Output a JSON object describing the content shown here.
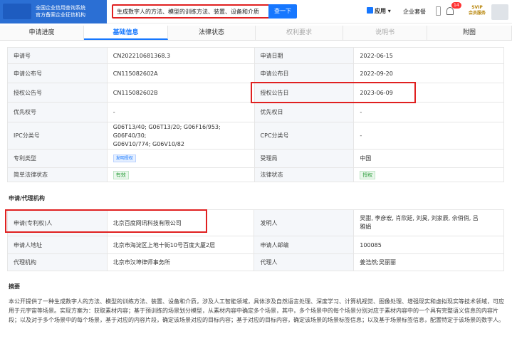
{
  "header": {
    "brand_line1": "全国企业信用查询系统",
    "brand_line2": "官方备案企业征信机构",
    "search_value": "生成数字人的方法、模型的训练方法、装置、设备和介质",
    "search_button": "查一下",
    "apps_label": "应用",
    "suite_label": "企业套餐",
    "notification_count": "14",
    "svip_line1": "SVIP",
    "svip_line2": "会员服务"
  },
  "tabs": [
    {
      "label": "申请进度"
    },
    {
      "label": "基础信息"
    },
    {
      "label": "法律状态"
    },
    {
      "label": "权利要求"
    },
    {
      "label": "说明书"
    },
    {
      "label": "附图"
    }
  ],
  "basic": {
    "app_no_label": "申请号",
    "app_no": "CN202210681368.3",
    "app_date_label": "申请日期",
    "app_date": "2022-06-15",
    "pub_no_label": "申请公布号",
    "pub_no": "CN115082602A",
    "pub_date_label": "申请公布日",
    "pub_date": "2022-09-20",
    "grant_no_label": "授权公告号",
    "grant_no": "CN115082602B",
    "grant_date_label": "授权公告日",
    "grant_date": "2023-06-09",
    "priority_no_label": "优先权号",
    "priority_no": "-",
    "priority_date_label": "优先权日",
    "priority_date": "-",
    "ipc_label": "IPC分类号",
    "ipc_line1": "G06T13/40; G06T13/20; G06F16/953; G06F40/30;",
    "ipc_line2": "G06V10/774; G06V10/82",
    "cpc_label": "CPC分类号",
    "cpc": "-",
    "type_label": "专利类型",
    "type": "发明授权",
    "office_label": "受理局",
    "office": "中国",
    "legal_label": "简单法律状态",
    "legal": "有效",
    "legal2_label": "法律状态",
    "legal2": "授权"
  },
  "agency": {
    "title": "申请/代理机构",
    "applicant_label": "申请(专利权)人",
    "applicant": "北京百度网讯科技有限公司",
    "inventor_label": "发明人",
    "inventor_line1": "吴甜, 李彦宏, 肖欣延, 刘昊, 刘家辰, 佘俏俏, 吕",
    "inventor_line2": "雅娟",
    "address_label": "申请人地址",
    "address": "北京市海淀区上地十街10号百度大厦2层",
    "zip_label": "申请人邮编",
    "zip": "100085",
    "agency_label": "代理机构",
    "agency_name": "北京市汉坤律师事务所",
    "agent_label": "代理人",
    "agent": "姜浩然;吴丽丽"
  },
  "abstract": {
    "title": "摘要",
    "text": "本公开提供了一种生成数字人的方法、模型的训练方法、装置、设备和介质，涉及人工智能领域，具体涉及自然语言处理、深度学习、计算机视觉、图像处理、增强现实和虚拟现实等技术领域，可应用于元宇宙等场景。实现方案为：获取素材内容；基于预训练的场景划分模型，从素材内容中确定多个场景，其中，多个场景中的每个场景分别对应于素材内容中的一个具有完整语义信息的内容片段；以及对于多个场景中的每个场景，基于对应的内容片段，确定该场景对应的目标内容；基于对应的目标内容，确定该场景的场景标签信息；以及基于场景标签信息，配置特定于该场景的数字人。"
  }
}
